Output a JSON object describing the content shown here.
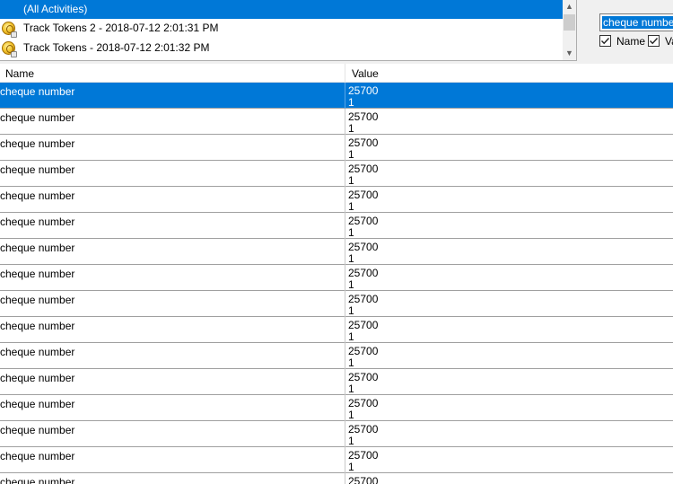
{
  "activities": {
    "items": [
      {
        "label": "(All Activities)",
        "selected": true,
        "icon": ""
      },
      {
        "label": "Track Tokens 2 - 2018-07-12 2:01:31 PM",
        "selected": false,
        "icon": "token-coin-icon"
      },
      {
        "label": "Track Tokens - 2018-07-12 2:01:32 PM",
        "selected": false,
        "icon": "token-coin-icon"
      }
    ]
  },
  "filter": {
    "value": "cheque number",
    "name_checkbox": {
      "label": "Name",
      "checked": true
    },
    "value_checkbox": {
      "label": "Value",
      "checked": true
    }
  },
  "grid": {
    "columns": [
      "Name",
      "Value"
    ],
    "rows": [
      {
        "name": "cheque number",
        "value": "25700\n1",
        "selected": true
      },
      {
        "name": "cheque number",
        "value": "25700\n1"
      },
      {
        "name": "cheque number",
        "value": "25700\n1"
      },
      {
        "name": "cheque number",
        "value": "25700\n1"
      },
      {
        "name": "cheque number",
        "value": "25700\n1"
      },
      {
        "name": "cheque number",
        "value": "25700\n1"
      },
      {
        "name": "cheque number",
        "value": "25700\n1"
      },
      {
        "name": "cheque number",
        "value": "25700\n1"
      },
      {
        "name": "cheque number",
        "value": "25700\n1"
      },
      {
        "name": "cheque number",
        "value": "25700\n1"
      },
      {
        "name": "cheque number",
        "value": "25700\n1"
      },
      {
        "name": "cheque number",
        "value": "25700\n1"
      },
      {
        "name": "cheque number",
        "value": "25700\n1"
      },
      {
        "name": "cheque number",
        "value": "25700\n1"
      },
      {
        "name": "cheque number",
        "value": "25700\n1"
      },
      {
        "name": "cheque number",
        "value": "25700"
      }
    ]
  },
  "colors": {
    "selection": "#0078d7",
    "row_border": "#a0a0a0"
  }
}
